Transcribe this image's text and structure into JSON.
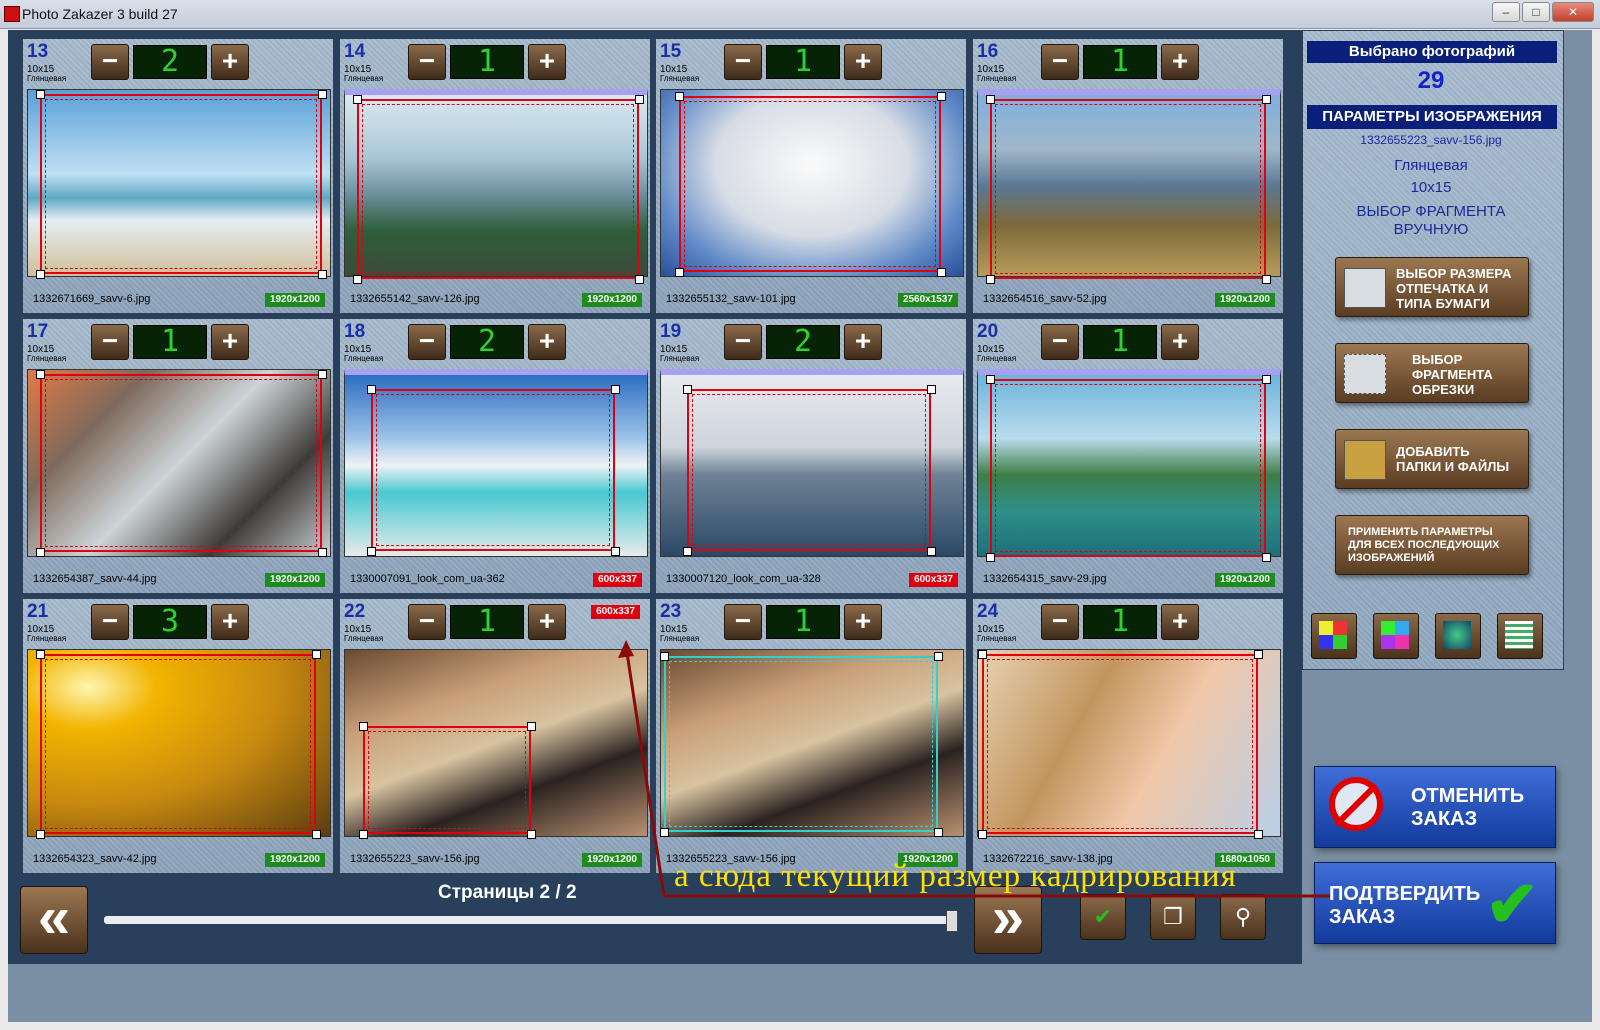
{
  "window": {
    "title": "Photo Zakazer 3 build 27"
  },
  "cells": [
    {
      "num": "13",
      "size": "10x15",
      "paper": "Глянцевая",
      "count": "2",
      "file": "1332671669_savv-6.jpg",
      "res": "1920x1200",
      "res_color": "green",
      "img": "sea"
    },
    {
      "num": "14",
      "size": "10x15",
      "paper": "Глянцевая",
      "count": "1",
      "file": "1332655142_savv-126.jpg",
      "res": "1920x1200",
      "res_color": "green",
      "img": "bay"
    },
    {
      "num": "15",
      "size": "10x15",
      "paper": "Глянцевая",
      "count": "1",
      "file": "1332655132_savv-101.jpg",
      "res": "2560x1537",
      "res_color": "green",
      "img": "tree"
    },
    {
      "num": "16",
      "size": "10x15",
      "paper": "Глянцевая",
      "count": "1",
      "file": "1332654516_savv-52.jpg",
      "res": "1920x1200",
      "res_color": "green",
      "img": "mount"
    },
    {
      "num": "17",
      "size": "10x15",
      "paper": "Глянцевая",
      "count": "1",
      "file": "1332654387_savv-44.jpg",
      "res": "1920x1200",
      "res_color": "green",
      "img": "splash"
    },
    {
      "num": "18",
      "size": "10x15",
      "paper": "Глянцевая",
      "count": "2",
      "file": "1330007091_look_com_ua-362",
      "res": "600x337",
      "res_color": "red",
      "img": "beach"
    },
    {
      "num": "19",
      "size": "10x15",
      "paper": "Глянцевая",
      "count": "2",
      "file": "1330007120_look_com_ua-328",
      "res": "600x337",
      "res_color": "red",
      "img": "lake"
    },
    {
      "num": "20",
      "size": "10x15",
      "paper": "Глянцевая",
      "count": "1",
      "file": "1332654315_savv-29.jpg",
      "res": "1920x1200",
      "res_color": "green",
      "img": "coast"
    },
    {
      "num": "21",
      "size": "10x15",
      "paper": "Глянцевая",
      "count": "3",
      "file": "1332654323_savv-42.jpg",
      "res": "1920x1200",
      "res_color": "green",
      "img": "sunset"
    },
    {
      "num": "22",
      "size": "10x15",
      "paper": "Глянцевая",
      "count": "1",
      "file": "1332655223_savv-156.jpg",
      "res": "1920x1200",
      "res_color": "green",
      "img": "girl",
      "crop_badge": "600x337"
    },
    {
      "num": "23",
      "size": "10x15",
      "paper": "Глянцевая",
      "count": "1",
      "file": "1332655223_savv-156.jpg",
      "res": "1920x1200",
      "res_color": "green",
      "img": "girl"
    },
    {
      "num": "24",
      "size": "10x15",
      "paper": "Глянцевая",
      "count": "1",
      "file": "1332672216_savv-138.jpg",
      "res": "1680x1050",
      "res_color": "green",
      "img": "face"
    }
  ],
  "nav": {
    "pages": "Страницы 2 / 2",
    "prev": "«",
    "next": "»"
  },
  "side": {
    "selected_label": "Выбрано фотографий",
    "selected_count": "29",
    "params_title": "ПАРАМЕТРЫ ИЗОБРАЖЕНИЯ",
    "file": "1332655223_savv-156.jpg",
    "paper": "Глянцевая",
    "size": "10x15",
    "mode": "ВЫБОР ФРАГМЕНТА ВРУЧНУЮ",
    "btn_size": "ВЫБОР РАЗМЕРА ОТПЕЧАТКА И ТИПА БУМАГИ",
    "btn_crop": "ВЫБОР ФРАГМЕНТА ОБРЕЗКИ",
    "btn_add": "ДОБАВИТЬ ПАПКИ И ФАЙЛЫ",
    "btn_apply": "ПРИМЕНИТЬ ПАРАМЕТРЫ ДЛЯ ВСЕХ ПОСЛЕДУЮЩИХ ИЗОБРАЖЕНИЙ",
    "cancel": "ОТМЕНИТЬ ЗАКАЗ",
    "confirm": "ПОДТВЕРДИТЬ ЗАКАЗ"
  },
  "annotation": "а сюда текущий размер кадрирования",
  "colors": {
    "accent_blue": "#0a1f7a",
    "res_green": "#1d8c1d",
    "res_red": "#e0000f",
    "counter_green": "#2fd12f"
  },
  "icons": [
    "app-icon",
    "minus-icon",
    "plus-icon",
    "chevron-left-icon",
    "chevron-right-icon",
    "check-icon",
    "copy-icon",
    "magnifier-icon",
    "cancel-icon",
    "confirm-check-icon"
  ]
}
